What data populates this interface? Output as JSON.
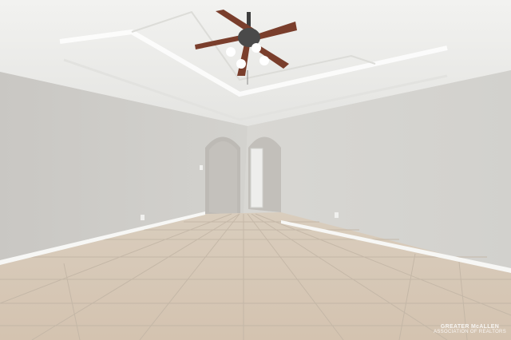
{
  "scene": {
    "subject": "empty-room-interior",
    "colors": {
      "ceiling": "#eeeeec",
      "wall_left": "#cfcdc9",
      "wall_right": "#d6d4d1",
      "floor": "#d7c9b8",
      "grout": "#bfb2a2",
      "baseboard": "#f6f6f4",
      "fan_blade": "#7a3e2c",
      "fan_metal": "#4a4a4a"
    }
  },
  "watermark": {
    "brand": "GREATER McALLEN",
    "sub": "ASSOCIATION OF REALTORS"
  }
}
